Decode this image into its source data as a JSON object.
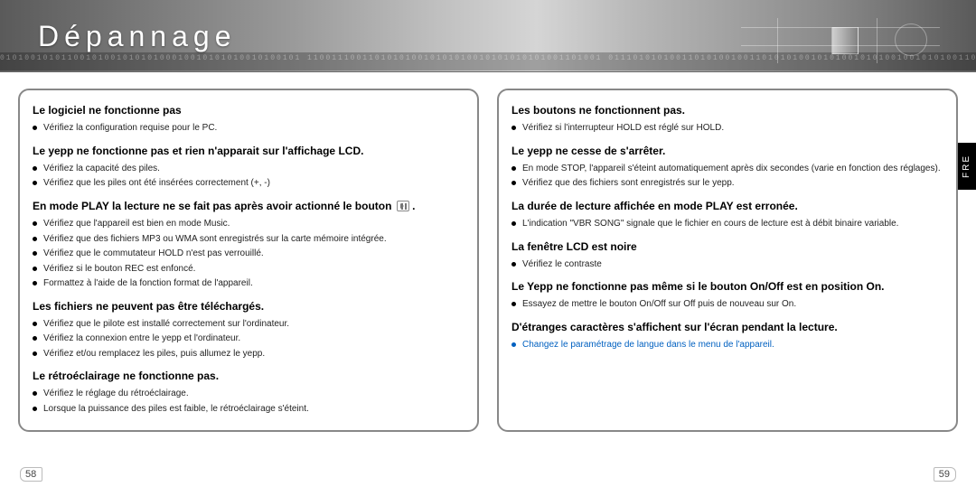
{
  "banner": {
    "title": "Dépannage",
    "binary": "0101001010110010100101010100010010101010010100101 110011100110101010010101010010101010101001101001 011101010100110101001001101010100101010010101001001010100110011011010100101010101100101001010100"
  },
  "side_tab": "FRE",
  "page_numbers": {
    "left": "58",
    "right": "59"
  },
  "left": {
    "s1_h": "Le logiciel ne fonctionne pas",
    "s1_li1": "Vérifiez la configuration requise pour le PC.",
    "s2_h": "Le yepp ne fonctionne pas et rien n'apparait sur l'affichage LCD.",
    "s2_li1": "Vérifiez la capacité des piles.",
    "s2_li2": "Vérifiez que les piles ont été insérées correctement (+, -)",
    "s3_h_a": "En mode PLAY la lecture ne se fait pas après avoir actionné le bouton",
    "s3_h_b": ".",
    "s3_li1": "Vérifiez que l'appareil est bien en mode Music.",
    "s3_li2": "Vérifiez que des fichiers MP3 ou WMA sont enregistrés sur la carte mémoire intégrée.",
    "s3_li3": "Vérifiez que le commutateur HOLD n'est pas verrouillé.",
    "s3_li4": "Vérifiez si le bouton REC est enfoncé.",
    "s3_li5": "Formattez à l'aide de la fonction format de l'appareil.",
    "s4_h": "Les fichiers ne peuvent pas être téléchargés.",
    "s4_li1": "Vérifiez que le pilote est installé correctement sur l'ordinateur.",
    "s4_li2": "Vérifiez la connexion entre le yepp et l'ordinateur.",
    "s4_li3": "Vérifiez et/ou remplacez les piles, puis allumez le yepp.",
    "s5_h": "Le rétroéclairage ne fonctionne pas.",
    "s5_li1": "Vérifiez le réglage du rétroéclairage.",
    "s5_li2": "Lorsque la puissance des piles est faible, le rétroéclairage s'éteint."
  },
  "right": {
    "s1_h": "Les boutons ne fonctionnent pas.",
    "s1_li1": "Vérifiez si l'interrupteur HOLD est réglé sur HOLD.",
    "s2_h": "Le yepp ne cesse de s'arrêter.",
    "s2_li1": "En mode STOP, l'appareil s'éteint automatiquement après dix secondes (varie en fonction des réglages).",
    "s2_li2": "Vérifiez que des fichiers sont enregistrés sur le yepp.",
    "s3_h": "La durée de lecture affichée en mode PLAY est erronée.",
    "s3_li1": "L'indication \"VBR SONG\" signale que le fichier en cours de lecture est à débit binaire variable.",
    "s4_h": "La fenêtre LCD est noire",
    "s4_li1": "Vérifiez le contraste",
    "s5_h": "Le Yepp ne fonctionne pas même si le bouton On/Off est en position On.",
    "s5_li1": "Essayez de mettre le bouton On/Off sur Off puis de nouveau sur On.",
    "s6_h": "D'étranges caractères s'affichent sur l'écran pendant la lecture.",
    "s6_li1": "Changez le paramétrage de langue dans le menu de l'appareil."
  }
}
